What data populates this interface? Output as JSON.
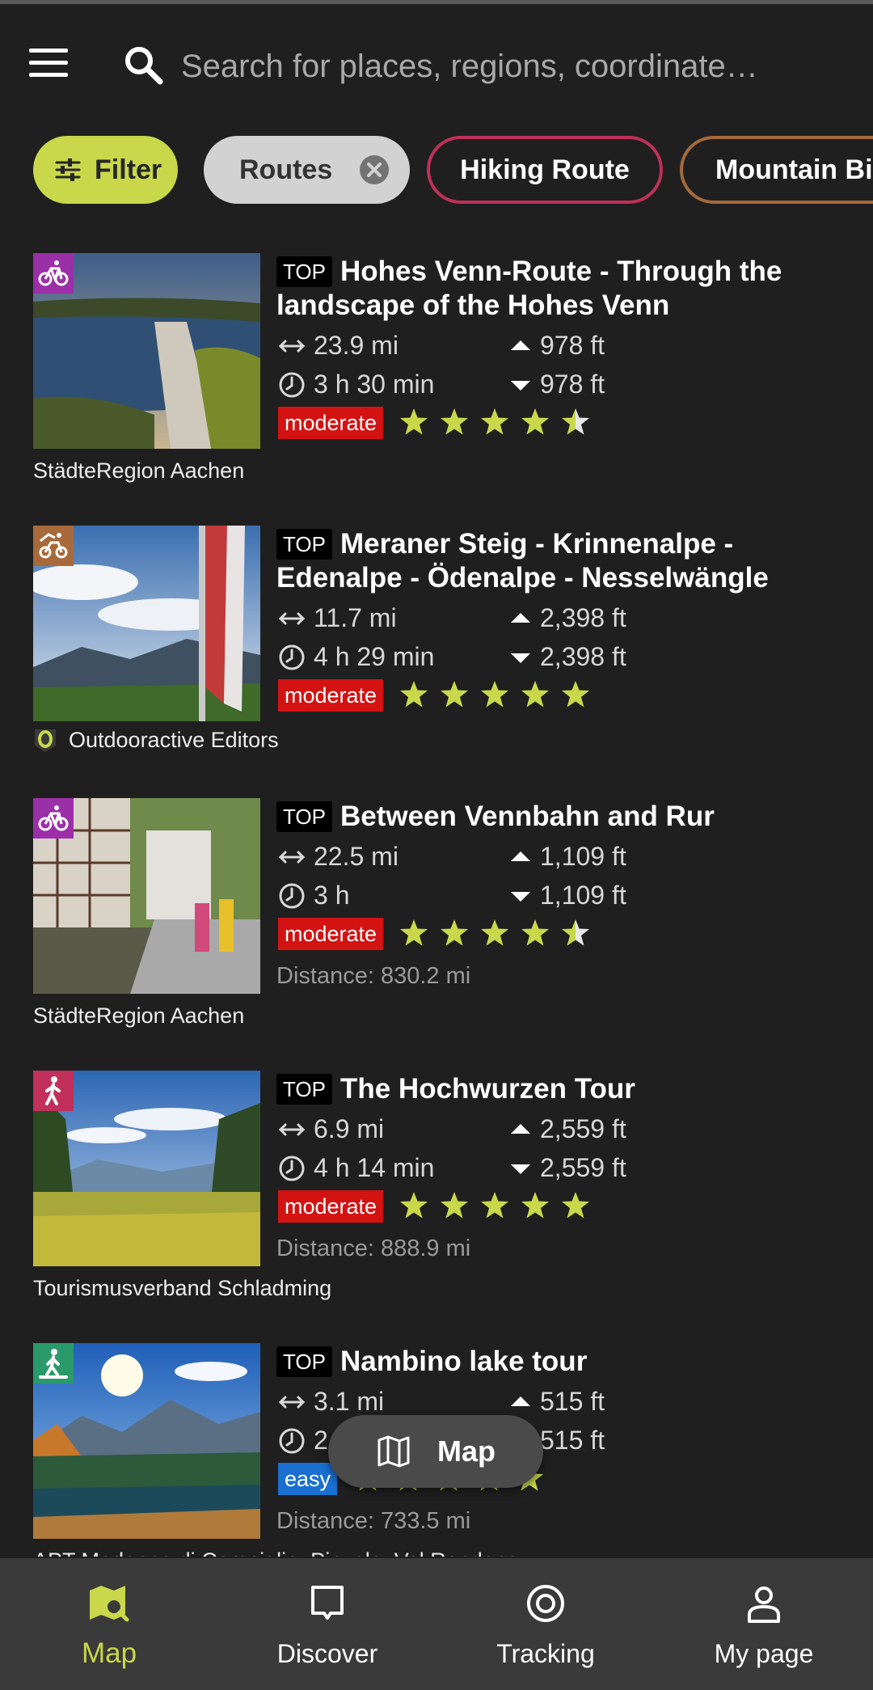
{
  "search": {
    "placeholder": "Search for places, regions, coordinate…"
  },
  "chips": {
    "filter": "Filter",
    "routes": "Routes",
    "hiking": "Hiking Route",
    "mtb": "Mountain Bi"
  },
  "colors": {
    "accent": "#c8d84a",
    "moderate": "#d31212",
    "easy": "#1a6fd0",
    "hiking_chip": "#c0305a",
    "mtb_chip": "#a56a3a"
  },
  "routes": [
    {
      "badge": "TOP",
      "title": "Hohes Venn-Route - Through the landscape of the Hohes Venn",
      "type_icon": "cycling-icon",
      "type_color": "#9b2fa8",
      "distance": "23.9 mi",
      "duration": "3 h 30 min",
      "ascent": "978 ft",
      "descent": "978 ft",
      "difficulty": "moderate",
      "rating": 4.5,
      "away": "",
      "source": "StädteRegion Aachen",
      "source_logo": false
    },
    {
      "badge": "TOP",
      "title": "Meraner Steig - Krinnenalpe - Edenalpe - Ödenalpe - Nesselwängle",
      "type_icon": "mountain-bike-icon",
      "type_color": "#a86a3a",
      "distance": "11.7 mi",
      "duration": "4 h 29 min",
      "ascent": "2,398 ft",
      "descent": "2,398 ft",
      "difficulty": "moderate",
      "rating": 5,
      "away": "",
      "source": "Outdooractive Editors",
      "source_logo": true
    },
    {
      "badge": "TOP",
      "title": "Between Vennbahn and Rur",
      "type_icon": "cycling-icon",
      "type_color": "#9b2fa8",
      "distance": "22.5 mi",
      "duration": "3 h",
      "ascent": "1,109 ft",
      "descent": "1,109 ft",
      "difficulty": "moderate",
      "rating": 4.5,
      "away": "Distance: 830.2 mi",
      "source": "StädteRegion Aachen",
      "source_logo": false
    },
    {
      "badge": "TOP",
      "title": "The Hochwurzen Tour",
      "type_icon": "hiking-icon",
      "type_color": "#c0305a",
      "distance": "6.9 mi",
      "duration": "4 h 14 min",
      "ascent": "2,559 ft",
      "descent": "2,559 ft",
      "difficulty": "moderate",
      "rating": 5,
      "away": "Distance: 888.9 mi",
      "source": "Tourismusverband Schladming",
      "source_logo": false
    },
    {
      "badge": "TOP",
      "title": "Nambino lake tour",
      "type_icon": "walking-icon",
      "type_color": "#2a9a6a",
      "distance": "3.1 mi",
      "duration": "2",
      "ascent": "515 ft",
      "descent": "515 ft",
      "difficulty": "easy",
      "rating": 5,
      "away": "Distance: 733.5 mi",
      "source": "APT Madonna di Campiglio, Pinzolo, Val Rendena",
      "source_logo": false
    }
  ],
  "map_button": "Map",
  "nav": [
    {
      "label": "Map",
      "icon": "map-icon"
    },
    {
      "label": "Discover",
      "icon": "discover-icon"
    },
    {
      "label": "Tracking",
      "icon": "tracking-icon"
    },
    {
      "label": "My page",
      "icon": "profile-icon"
    }
  ]
}
